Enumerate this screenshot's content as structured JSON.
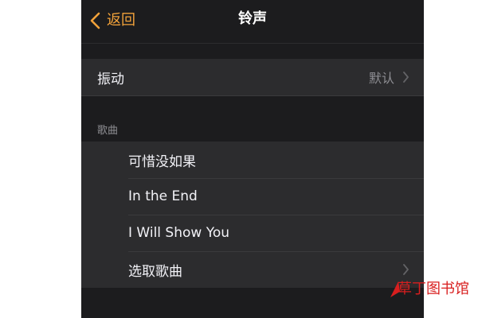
{
  "navbar": {
    "back_label": "返回",
    "title": "铃声"
  },
  "vibration": {
    "label": "振动",
    "value": "默认"
  },
  "songs": {
    "section_header": "歌曲",
    "items": [
      {
        "label": "可惜没如果"
      },
      {
        "label": "In the End"
      },
      {
        "label": "I Will Show You"
      },
      {
        "label": "选取歌曲"
      }
    ]
  },
  "next_section": {
    "header": ""
  },
  "watermark": {
    "text": "草丁图书馆"
  },
  "colors": {
    "background": "#1c1c1e",
    "cell": "#2c2c2e",
    "accent": "#f2a23a",
    "secondary_text": "#8e8e93",
    "watermark": "#d81e1e"
  },
  "icons": {
    "back": "chevron-left-icon",
    "disclosure": "chevron-right-icon"
  }
}
